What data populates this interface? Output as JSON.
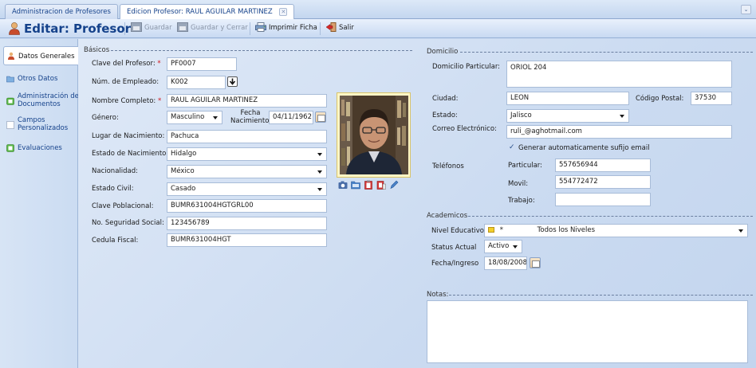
{
  "tabs": [
    {
      "label": "Administracion de Profesores",
      "active": false
    },
    {
      "label": "Edicion Profesor: RAUL AGUILAR MARTINEZ",
      "active": true
    }
  ],
  "toolbar": {
    "title": "Editar: Profesor",
    "save_label": "Guardar",
    "save_close_label": "Guardar y Cerrar",
    "print_label": "Imprimir Ficha",
    "exit_label": "Salir"
  },
  "sidebar": {
    "items": [
      {
        "label": "Datos Generales",
        "icon": "user-icon",
        "active": true
      },
      {
        "label": "Otros Datos",
        "icon": "folder-icon",
        "active": false
      },
      {
        "label": "Administración de Documentos",
        "label_line1": "Administración de",
        "label_line2": "Documentos",
        "icon": "documents-icon",
        "active": false
      },
      {
        "label": "Campos Personalizados",
        "label_line1": "Campos",
        "label_line2": "Personalizados",
        "icon": "custom-fields-icon",
        "active": false
      },
      {
        "label": "Evaluaciones",
        "icon": "evaluation-icon",
        "active": false
      }
    ]
  },
  "basicos": {
    "section_title": "Básicos",
    "clave_profesor": {
      "label": "Clave del Profesor:",
      "required": "*",
      "value": "PF0007"
    },
    "num_empleado": {
      "label": "Núm. de Empleado:",
      "value": "K002"
    },
    "nombre_completo": {
      "label": "Nombre Completo:",
      "required": "*",
      "value": "RAUL AGUILAR MARTINEZ"
    },
    "genero": {
      "label": "Género:",
      "value": "Masculino"
    },
    "fecha_nacimiento": {
      "label_line1": "Fecha",
      "label_line2": "Nacimiento:",
      "value": "04/11/1962"
    },
    "lugar_nacimiento": {
      "label": "Lugar de Nacimiento:",
      "value": "Pachuca"
    },
    "estado_nacimiento": {
      "label": "Estado de Nacimiento:",
      "value": "Hidalgo"
    },
    "nacionalidad": {
      "label": "Nacionalidad:",
      "value": "México"
    },
    "estado_civil": {
      "label": "Estado Civil:",
      "value": "Casado"
    },
    "clave_poblacional": {
      "label": "Clave Poblacional:",
      "value": "BUMR631004HGTGRL00"
    },
    "seguridad_social": {
      "label": "No. Seguridad Social:",
      "value": "123456789"
    },
    "cedula_fiscal": {
      "label": "Cedula Fiscal:",
      "value": "BUMR631004HGT"
    }
  },
  "domicilio": {
    "section_title": "Domicilio",
    "domicilio_particular": {
      "label": "Domicilio Particular:",
      "value": "ORIOL  204"
    },
    "ciudad": {
      "label": "Ciudad:",
      "value": "LEON"
    },
    "codigo_postal": {
      "label": "Código Postal:",
      "value": "37530"
    },
    "estado": {
      "label": "Estado:",
      "value": "Jalisco"
    },
    "correo": {
      "label": "Correo Electrónico:",
      "value": "ruli_@aghotmail.com"
    },
    "generar_sufijo": {
      "label": "Generar automaticamente sufijo email",
      "checked": true
    },
    "telefonos": {
      "label": "Teléfonos",
      "particular": {
        "label": "Particular:",
        "value": "557656944"
      },
      "movil": {
        "label": "Movil:",
        "value": "554772472"
      },
      "trabajo": {
        "label": "Trabajo:",
        "value": ""
      }
    }
  },
  "academicos": {
    "section_title": "Academicos",
    "nivel_educativo": {
      "label": "Nivel Educativo:",
      "marker": "*",
      "value": "Todos los Niveles"
    },
    "status_actual": {
      "label": "Status Actual",
      "value": "Activo"
    },
    "fecha_ingreso": {
      "label": "Fecha/Ingreso",
      "value": "18/08/2008"
    }
  },
  "notas": {
    "section_title": "Notas:",
    "value": ""
  },
  "colors": {
    "accent": "#15428b",
    "required": "#d2141a",
    "background": "#c9daf1"
  }
}
